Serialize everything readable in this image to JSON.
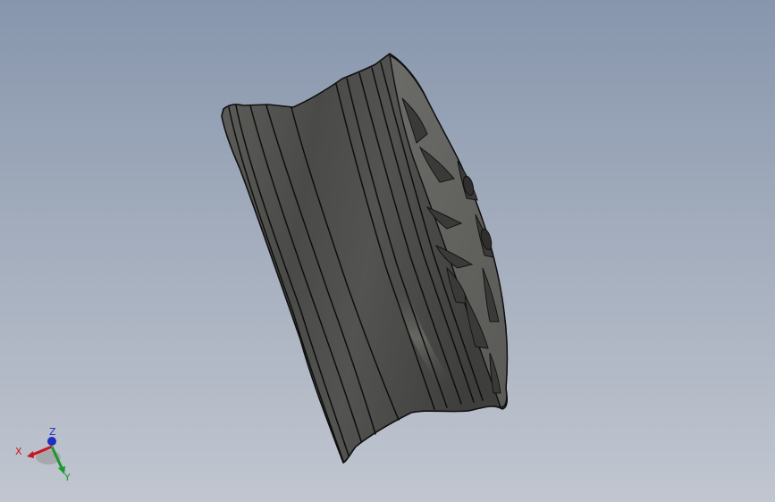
{
  "viewport": {
    "background_top": "#8796ad",
    "background_bottom": "#c1c6d0"
  },
  "model": {
    "icon": "wheel-rim-model",
    "body_color": "#4c4c4a",
    "edge_color": "#101010"
  },
  "triad": {
    "x_label": "X",
    "y_label": "Y",
    "z_label": "Z",
    "x_color": "#c8161e",
    "y_color": "#1a9a2a",
    "z_color": "#1f2fbf"
  }
}
